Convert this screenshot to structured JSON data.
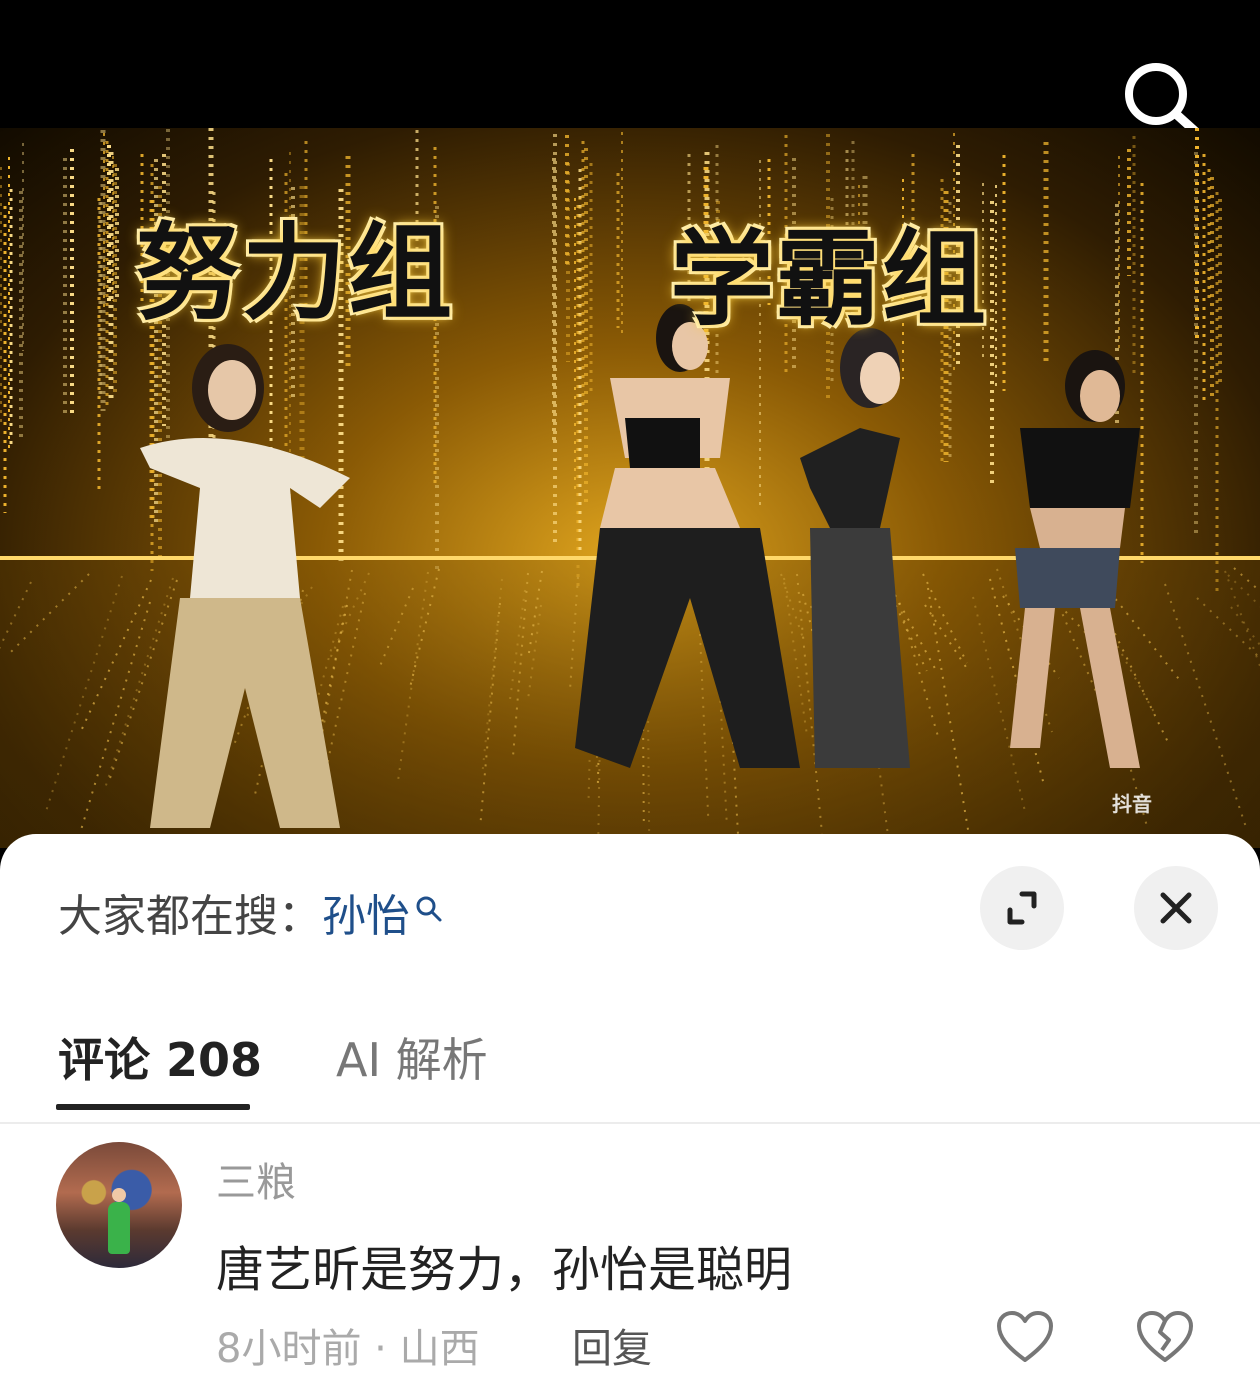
{
  "video": {
    "title_left": "努力组",
    "title_right": "学霸组",
    "watermark": "抖音"
  },
  "hot_search": {
    "prefix": "大家都在搜：",
    "keyword": "孙怡"
  },
  "tabs": {
    "comments_label": "评论",
    "comments_count": "208",
    "ai_label": "AI 解析"
  },
  "comment": {
    "username": "三粮",
    "text": "唐艺昕是努力，孙怡是聪明",
    "time_location": "8小时前 · 山西",
    "reply_label": "回复"
  },
  "colors": {
    "keyword": "#1f4f8a",
    "gold": "#e0a51e"
  },
  "icons": [
    "search-icon",
    "expand-icon",
    "close-icon",
    "heart-icon",
    "broken-heart-icon"
  ]
}
